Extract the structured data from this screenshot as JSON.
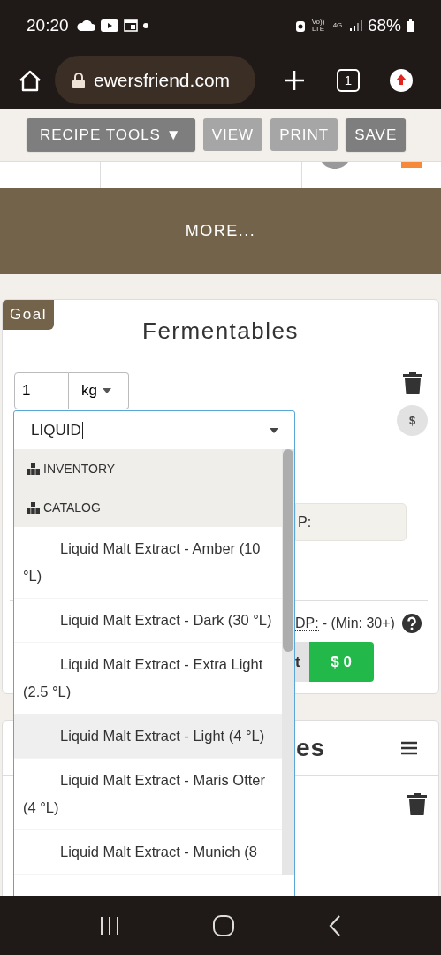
{
  "status_bar": {
    "time": "20:20",
    "network_labels": [
      "Vo)) LTE",
      "4G"
    ],
    "battery": "68%"
  },
  "browser": {
    "url": "ewersfriend.com",
    "tab_count": "1"
  },
  "toolbar": {
    "buttons": [
      {
        "label": "RECIPE TOOLS ▼",
        "disabled": false
      },
      {
        "label": "VIEW",
        "disabled": true
      },
      {
        "label": "PRINT",
        "disabled": true
      },
      {
        "label": "SAVE",
        "disabled": false
      }
    ]
  },
  "more_button": "MORE...",
  "fermentables": {
    "badge": "Goal",
    "title": "Fermentables",
    "amount": "1",
    "unit": "kg",
    "price_symbol": "$",
    "field_label": "P:",
    "dp_label": "DP:",
    "dp_value": "- (Min: 30+)",
    "cost_buttons": [
      {
        "label": "t",
        "selected": false
      },
      {
        "label": "$ 0",
        "selected": true
      }
    ]
  },
  "dropdown": {
    "query": "LIQUID",
    "groups": [
      "INVENTORY",
      "CATALOG"
    ],
    "items": [
      {
        "label": "Liquid Malt Extract - Amber (10 °L)",
        "selected": false
      },
      {
        "label": "Liquid Malt Extract - Dark (30 °L)",
        "selected": false
      },
      {
        "label": "Liquid Malt Extract - Extra Light (2.5 °L)",
        "selected": false
      },
      {
        "label": "Liquid Malt Extract - Light (4 °L)",
        "selected": true
      },
      {
        "label": "Liquid Malt Extract - Maris Otter (4 °L)",
        "selected": false
      },
      {
        "label": "Liquid Malt Extract - Munich (8",
        "selected": false
      }
    ]
  },
  "next_section": {
    "title": "es"
  }
}
